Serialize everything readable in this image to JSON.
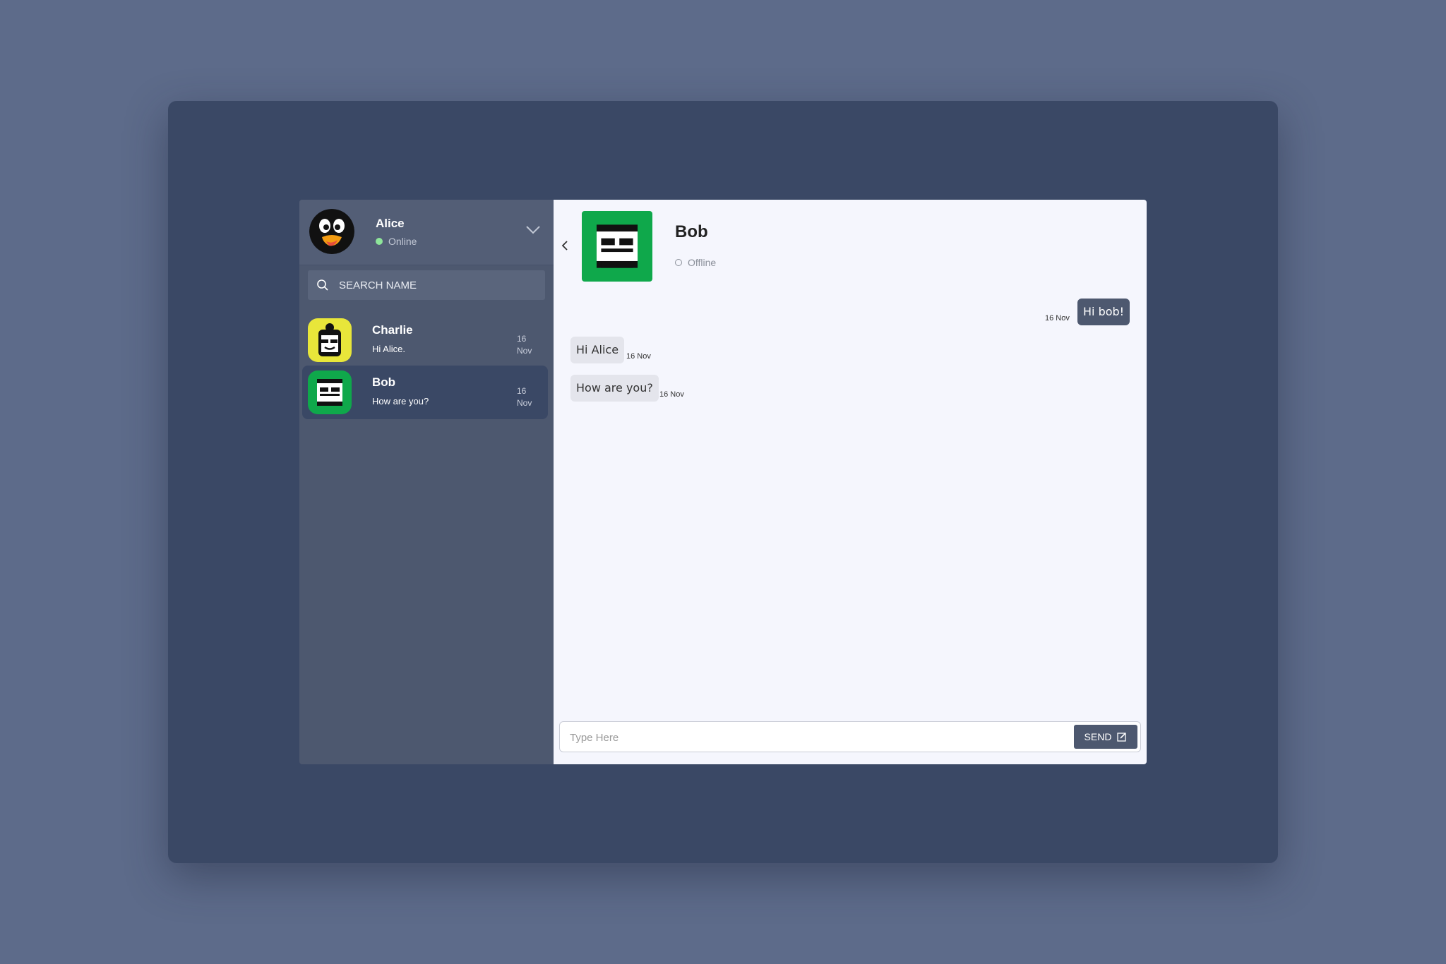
{
  "user": {
    "name": "Alice",
    "status": "Online",
    "avatar_icon": "penguin-avatar-icon"
  },
  "search": {
    "placeholder": "SEARCH NAME"
  },
  "contacts": [
    {
      "name": "Charlie",
      "last_message": "Hi Alice.",
      "date": "16 Nov",
      "avatar_color": "#e8e63a",
      "active": false
    },
    {
      "name": "Bob",
      "last_message": "How are you?",
      "date": "16 Nov",
      "avatar_color": "#0fa84b",
      "active": true
    }
  ],
  "chat": {
    "name": "Bob",
    "status": "Offline",
    "avatar_color": "#0fa84b",
    "messages": [
      {
        "text": "Hi bob!",
        "date": "16 Nov",
        "direction": "outgoing"
      },
      {
        "text": "Hi Alice",
        "date": "16 Nov",
        "direction": "incoming"
      },
      {
        "text": "How are you?",
        "date": "16 Nov",
        "direction": "incoming"
      }
    ]
  },
  "composer": {
    "placeholder": "Type Here",
    "send_label": "SEND"
  },
  "colors": {
    "background": "#5d6b8a",
    "frame": "#3a4865",
    "sidebar": "#4d586f",
    "chat_bg": "#f5f6fd",
    "online": "#8ee59a"
  }
}
